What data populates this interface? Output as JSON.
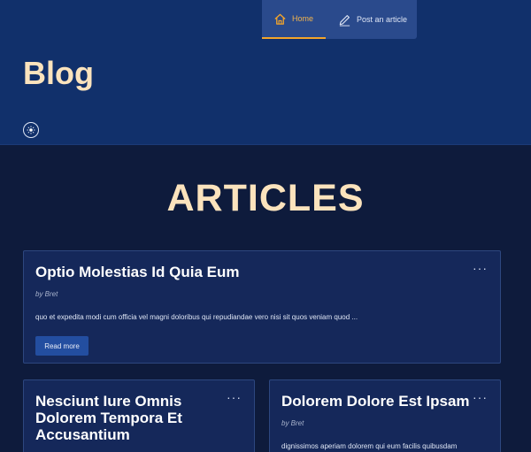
{
  "nav": {
    "home_label": "Home",
    "post_label": "Post an article"
  },
  "header": {
    "title": "Blog",
    "theme_toggle_icon": "sun-icon"
  },
  "main": {
    "heading": "ARTICLES",
    "articles": [
      {
        "title": "Optio Molestias Id Quia Eum",
        "author": "by Bret",
        "excerpt": "quo et expedita modi cum officia vel magni doloribus qui repudiandae vero nisi sit quos veniam quod ...",
        "read_more": "Read more",
        "menu": "···"
      },
      {
        "title": "Nesciunt Iure Omnis Dolorem Tempora Et Accusantium",
        "menu": "···"
      },
      {
        "title": "Dolorem Dolore Est Ipsam",
        "author": "by Bret",
        "excerpt": "dignissimos aperiam dolorem qui eum facilis quibusdam",
        "menu": "···"
      }
    ]
  },
  "colors": {
    "accent": "#f4a52a",
    "heading": "#fbe3bd",
    "header_bg": "#11306b",
    "page_bg": "#0e1b3c",
    "card_bg": "#15285a",
    "button_bg": "#234ea0"
  }
}
